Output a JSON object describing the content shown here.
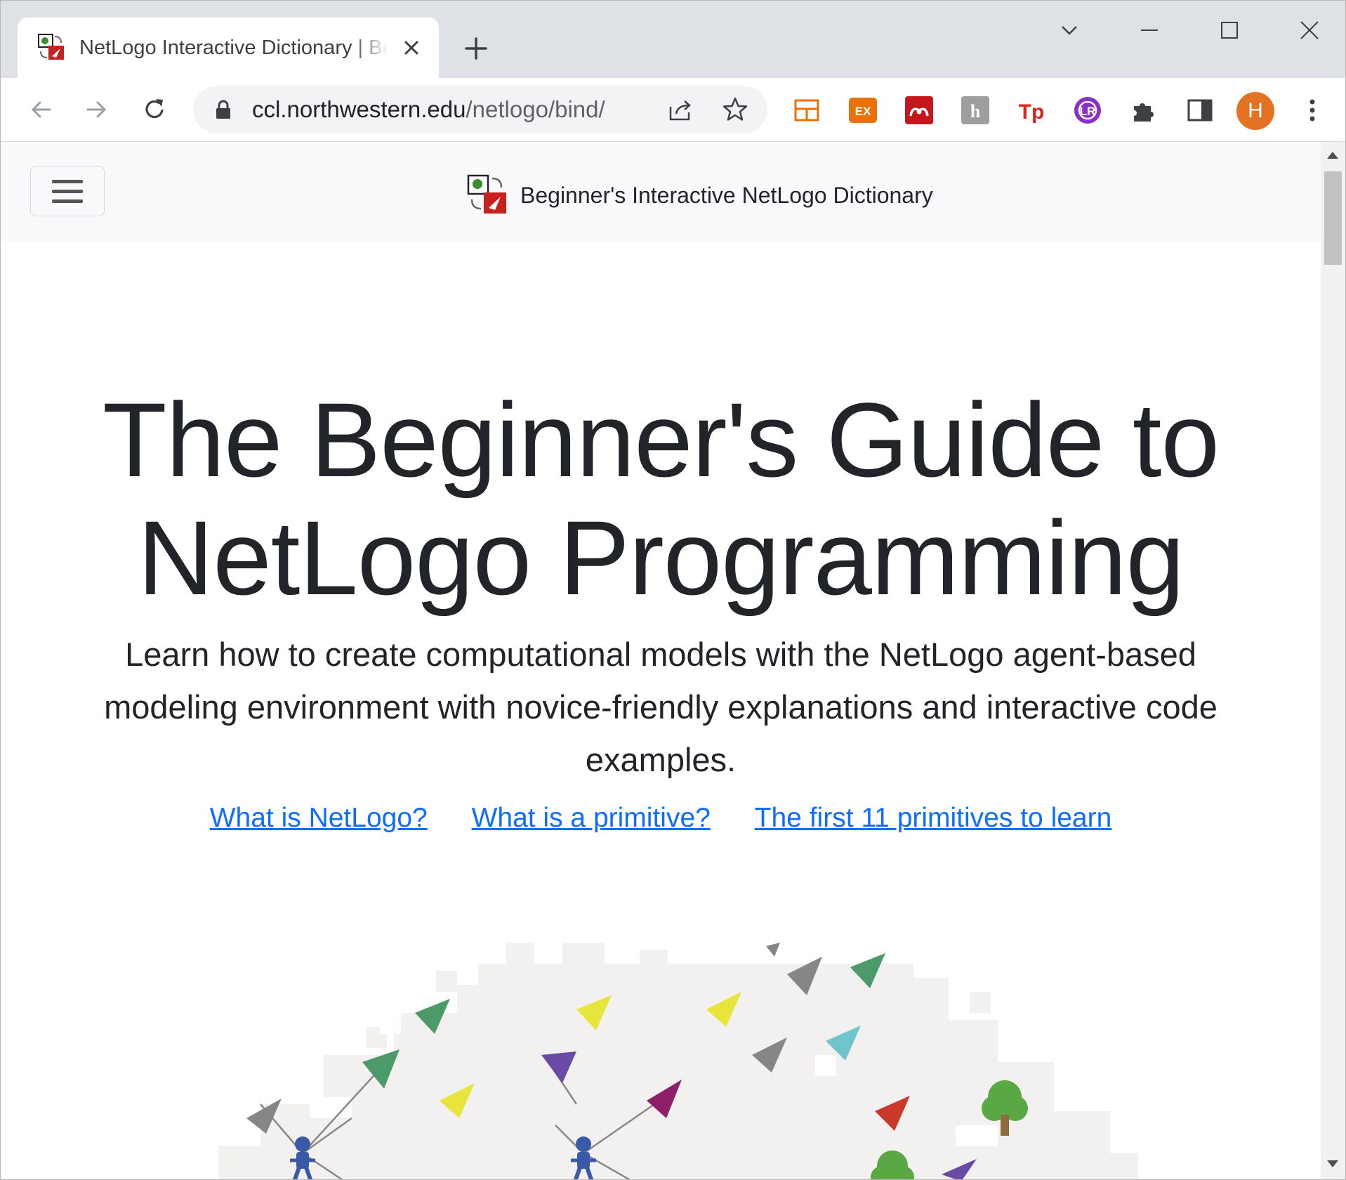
{
  "browser": {
    "tab": {
      "title": "NetLogo Interactive Dictionary | Beginner's Interactive NetLogo Dictionary"
    },
    "address_bar": {
      "host": "ccl.northwestern.edu",
      "path": "/netlogo/bind/"
    },
    "profile_initial": "H",
    "colors": {
      "tabstrip": "#dee1e6",
      "omnibox": "#f1f3f4",
      "avatar": "#e37222"
    }
  },
  "page": {
    "navbar": {
      "brand": "Beginner's Interactive NetLogo Dictionary"
    },
    "hero": {
      "title_line1": "The Beginner's Guide to",
      "title_line2": "NetLogo Programming",
      "lead": "Learn how to create computational models with the NetLogo agent-based modeling environment with novice-friendly explanations and interactive code examples."
    },
    "links": [
      "What is NetLogo?",
      "What is a primitive?",
      "The first 11 primitives to learn"
    ],
    "colors": {
      "link": "#0d6efd",
      "text": "#212529",
      "navbar_bg": "#f8f9fa"
    }
  }
}
